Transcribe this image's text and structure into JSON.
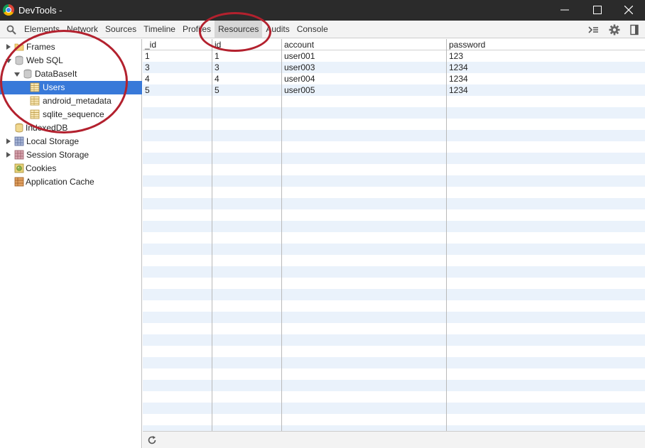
{
  "window": {
    "title": "DevTools -"
  },
  "toolbar": {
    "tabs": [
      {
        "label": "Elements",
        "active": false
      },
      {
        "label": "Network",
        "active": false
      },
      {
        "label": "Sources",
        "active": false
      },
      {
        "label": "Timeline",
        "active": false
      },
      {
        "label": "Profiles",
        "active": false
      },
      {
        "label": "Resources",
        "active": true
      },
      {
        "label": "Audits",
        "active": false
      },
      {
        "label": "Console",
        "active": false
      }
    ],
    "icons": [
      "search-icon",
      "console-drawer-icon",
      "settings-gear-icon",
      "dock-side-icon"
    ]
  },
  "sidebar": {
    "items": [
      {
        "label": "Frames",
        "icon": "folder-icon",
        "expanded": false
      },
      {
        "label": "Web SQL",
        "icon": "database-icon",
        "expanded": true
      },
      {
        "label": "DataBaseIt",
        "icon": "database-icon",
        "expanded": true
      },
      {
        "label": "Users",
        "icon": "table-icon",
        "selected": true
      },
      {
        "label": "android_metadata",
        "icon": "table-icon"
      },
      {
        "label": "sqlite_sequence",
        "icon": "table-icon"
      },
      {
        "label": "IndexedDB",
        "icon": "database-icon"
      },
      {
        "label": "Local Storage",
        "icon": "storage-grid-icon",
        "expanded": false
      },
      {
        "label": "Session Storage",
        "icon": "storage-grid-icon",
        "expanded": false
      },
      {
        "label": "Cookies",
        "icon": "cookie-icon"
      },
      {
        "label": "Application Cache",
        "icon": "app-cache-icon"
      }
    ]
  },
  "table": {
    "columns": [
      "_id",
      "id",
      "account",
      "password"
    ],
    "rows": [
      [
        "1",
        "1",
        "user001",
        "123"
      ],
      [
        "3",
        "3",
        "user003",
        "1234"
      ],
      [
        "4",
        "4",
        "user004",
        "1234"
      ],
      [
        "5",
        "5",
        "user005",
        "1234"
      ]
    ]
  },
  "statusbar": {
    "icon": "refresh-icon"
  },
  "colors": {
    "selection": "#3879d9",
    "annotation": "#b3212e",
    "row_alt": "#eaf2fb",
    "titlebar": "#2b2b2b"
  }
}
